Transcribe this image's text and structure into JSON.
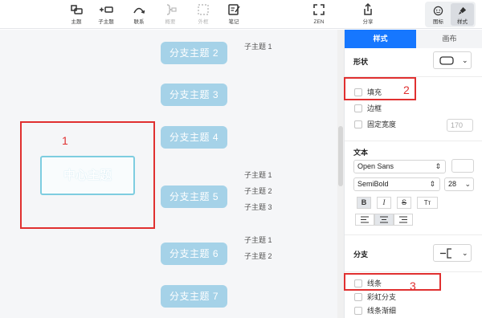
{
  "toolbar": {
    "buttons": [
      {
        "label": "主题",
        "icon": "topic-icon"
      },
      {
        "label": "子主题",
        "icon": "subtopic-icon"
      },
      {
        "label": "联系",
        "icon": "relationship-icon"
      },
      {
        "label": "概要",
        "icon": "summary-icon"
      },
      {
        "label": "外框",
        "icon": "boundary-icon"
      },
      {
        "label": "笔记",
        "icon": "note-icon"
      },
      {
        "label": "ZEN",
        "icon": "zen-icon"
      },
      {
        "label": "分享",
        "icon": "share-icon"
      }
    ],
    "view_switch": [
      {
        "label": "图标",
        "icon": "smiley-icon"
      },
      {
        "label": "样式",
        "icon": "brush-icon"
      }
    ]
  },
  "canvas": {
    "central_topic": "中心主题",
    "branches": [
      {
        "label": "分支主题 2",
        "subtopics": [
          "子主题 1"
        ]
      },
      {
        "label": "分支主题 3",
        "subtopics": []
      },
      {
        "label": "分支主题 4",
        "subtopics": []
      },
      {
        "label": "分支主题 5",
        "subtopics": [
          "子主题 1",
          "子主题 2",
          "子主题 3"
        ]
      },
      {
        "label": "分支主题 6",
        "subtopics": [
          "子主题 1",
          "子主题 2"
        ]
      },
      {
        "label": "分支主题 7",
        "subtopics": []
      }
    ],
    "annotations": [
      "1",
      "2",
      "3"
    ],
    "annotation_color": "#e03030"
  },
  "panel": {
    "tabs": [
      "样式",
      "画布"
    ],
    "accent_color": "#1677ff",
    "shape_label": "形状",
    "checkboxes_shape": [
      {
        "label": "填充",
        "checked": false
      },
      {
        "label": "边框",
        "checked": false
      },
      {
        "label": "固定宽度",
        "checked": false
      }
    ],
    "fixed_width_value": "170",
    "text_label": "文本",
    "font_family": "Open Sans",
    "font_weight": "SemiBold",
    "font_size": "28",
    "format_buttons": [
      "B",
      "I",
      "S",
      "Tт"
    ],
    "align_buttons": [
      "left",
      "center",
      "right"
    ],
    "branch_label": "分支",
    "checkboxes_branch": [
      {
        "label": "线条",
        "checked": false
      },
      {
        "label": "彩虹分支",
        "checked": false
      },
      {
        "label": "线条渐细",
        "checked": false
      }
    ]
  }
}
